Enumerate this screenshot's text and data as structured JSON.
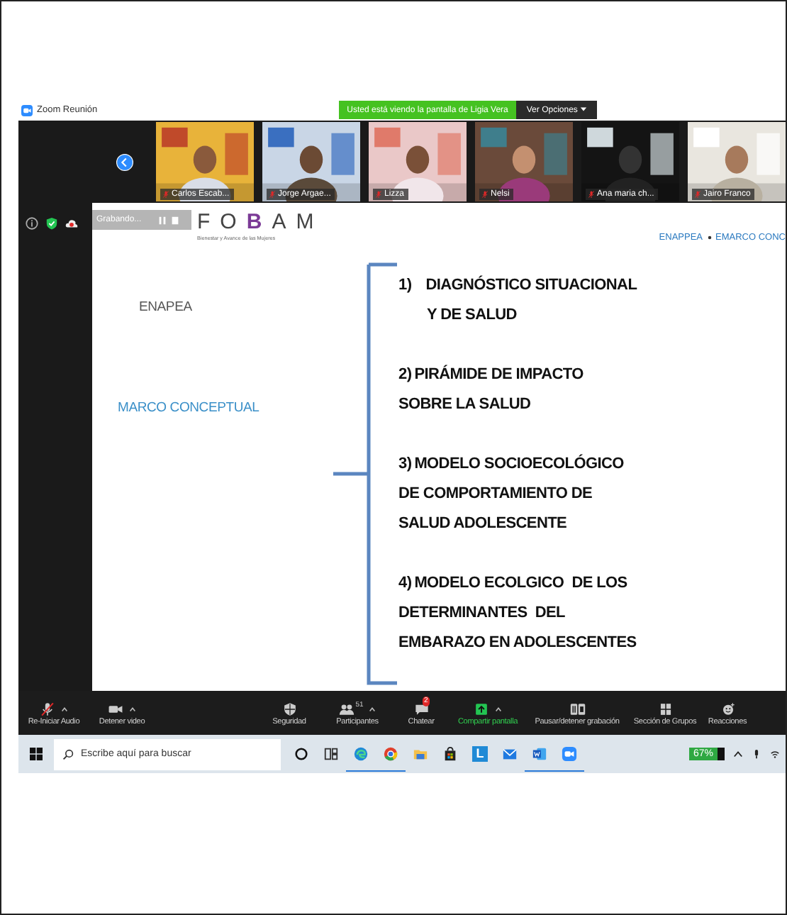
{
  "window": {
    "title": "Zoom Reunión"
  },
  "share_banner": {
    "text": "Usted está viendo la pantalla de Ligia Vera",
    "options": "Ver Opciones"
  },
  "participants": [
    {
      "name": "Carlos Escab...",
      "muted": true
    },
    {
      "name": "Jorge Argae...",
      "muted": true
    },
    {
      "name": "Lizza",
      "muted": true
    },
    {
      "name": "Nelsi",
      "muted": true
    },
    {
      "name": "Ana maria ch...",
      "muted": true
    },
    {
      "name": "Jairo Franco",
      "muted": true
    }
  ],
  "recording": {
    "label": "Grabando..."
  },
  "slide": {
    "logo": [
      {
        "text": "F",
        "accent": false
      },
      {
        "text": "O",
        "accent": false
      },
      {
        "text": "B",
        "accent": true
      },
      {
        "text": "A",
        "accent": false
      },
      {
        "text": "M",
        "accent": false
      }
    ],
    "tagline": "Bienestar y Avance de las Mujeres",
    "breadcrumb": [
      "ENAPPEA",
      "EMARCO CONC"
    ],
    "sections": [
      {
        "text": "ENAPEA",
        "color": "#555555"
      },
      {
        "text": "MARCO CONCEPTUAL",
        "color": "#3a8fc8"
      }
    ],
    "items": [
      {
        "number": "1)",
        "lines": [
          "DIAGNÓSTICO SITUACIONAL",
          "Y DE SALUD"
        ]
      },
      {
        "number": "2)",
        "lines": [
          "PIRÁMIDE DE IMPACTO",
          "SOBRE LA SALUD"
        ]
      },
      {
        "number": "3)",
        "lines": [
          "MODELO SOCIOECOLÓGICO",
          "DE COMPORTAMIENTO DE",
          "SALUD ADOLESCENTE"
        ]
      },
      {
        "number": "4)",
        "lines": [
          "MODELO ECOLGICO  DE LOS",
          "DETERMINANTES  DEL",
          "EMBARAZO EN ADOLESCENTES"
        ]
      }
    ]
  },
  "toolbar": [
    {
      "kind": "mic-off",
      "label": "Re-Iniciar Audio",
      "caret": true,
      "highlighted": false
    },
    {
      "kind": "camera",
      "label": "Detener video",
      "caret": true,
      "highlighted": false
    },
    {
      "kind": "shield",
      "label": "Seguridad",
      "caret": false,
      "highlighted": false
    },
    {
      "kind": "people",
      "label": "Participantes",
      "count": "51",
      "caret": true,
      "highlighted": false
    },
    {
      "kind": "chat",
      "label": "Chatear",
      "badge": "2",
      "caret": false,
      "highlighted": false
    },
    {
      "kind": "share",
      "label": "Compartir pantalla",
      "caret": true,
      "highlighted": true
    },
    {
      "kind": "pause-stop",
      "label": "Pausar/detener grabación",
      "caret": false,
      "highlighted": false
    },
    {
      "kind": "grid",
      "label": "Sección de Grupos",
      "caret": false,
      "highlighted": false
    },
    {
      "kind": "smiley",
      "label": "Reacciones",
      "caret": false,
      "highlighted": false
    }
  ],
  "taskbar": {
    "search": {
      "placeholder": "Escribe aquí para buscar"
    },
    "apps": [
      {
        "kind": "cortana",
        "running": false
      },
      {
        "kind": "task-view",
        "running": false
      },
      {
        "kind": "edge",
        "running": true
      },
      {
        "kind": "chrome",
        "running": true
      },
      {
        "kind": "folder",
        "running": false
      },
      {
        "kind": "store",
        "running": false
      },
      {
        "kind": "letter",
        "letter": "L",
        "running": false
      },
      {
        "kind": "mail",
        "running": false
      },
      {
        "kind": "word",
        "running": true
      },
      {
        "kind": "zoom",
        "running": true
      }
    ],
    "battery": "67%"
  }
}
